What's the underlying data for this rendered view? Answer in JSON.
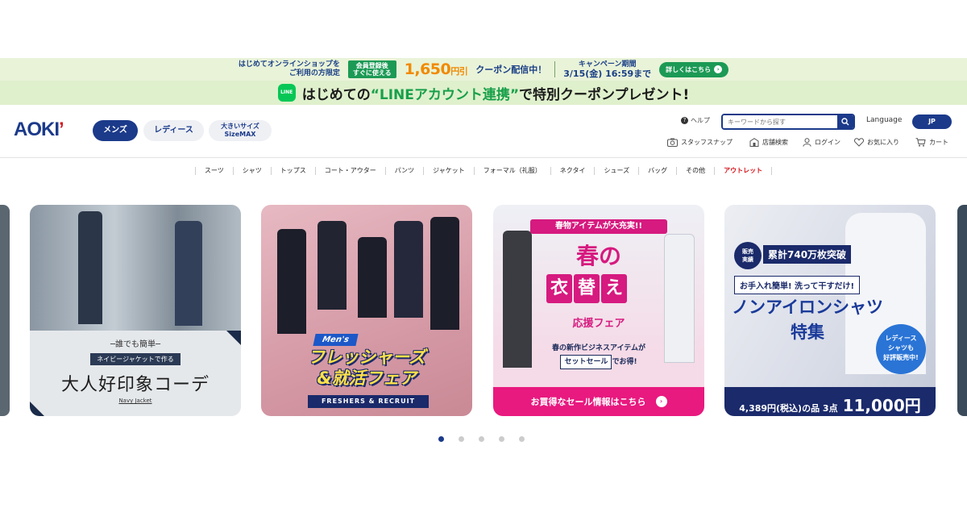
{
  "promo_top": {
    "lead_line1": "はじめてオンラインショップを",
    "lead_line2": "ご利用の方限定",
    "tag_line1": "会員登録後",
    "tag_line2": "すぐに使える",
    "amount": "1,650",
    "amount_unit": "円引",
    "coupon": "クーポン配信中！",
    "period_label": "キャンペーン期間",
    "period_value": "3/15(金) 16:59まで",
    "detail_button": "詳しくはこちら"
  },
  "promo_line": {
    "logo": "LINE",
    "text_pre": "はじめての",
    "text_em": "“LINEアカウント連携”",
    "text_post": "で特別クーポンプレゼント!"
  },
  "header": {
    "logo": "AOKI",
    "logo_mark": "’",
    "categories": [
      "メンズ",
      "レディース"
    ],
    "large_size_line1": "大きいサイズ",
    "large_size_line2": "SizeMAX",
    "help": "ヘルプ",
    "search_placeholder": "キーワードから探す",
    "language_label": "Language",
    "language_value": "JP",
    "utility": [
      "スタッフスナップ",
      "店舗検索",
      "ログイン",
      "お気に入り",
      "カート"
    ]
  },
  "nav": [
    "スーツ",
    "シャツ",
    "トップス",
    "コート・アウター",
    "パンツ",
    "ジャケット",
    "フォーマル（礼服）",
    "ネクタイ",
    "シューズ",
    "バッグ",
    "その他",
    "アウトレット"
  ],
  "carousel": {
    "card1": {
      "line1": "─誰でも簡単─",
      "line2": "ネイビージャケットで作る",
      "title": "大人好印象コーデ",
      "sub": "Navy Jacket"
    },
    "card2": {
      "label": "Men's",
      "title_line1": "フレッシャーズ",
      "title_line2": "&就活フェア",
      "sub": "FRESHERS & RECRUIT"
    },
    "card3": {
      "top": "春物アイテムが大充実!!",
      "haru": "春の",
      "koromo": [
        "衣",
        "替",
        "え"
      ],
      "ouen": "応援フェア",
      "desc_line1": "春の新作ビジネスアイテムが",
      "desc_box": "セットセール",
      "desc_line2": "でお得!",
      "bottom": "お買得なセール情報はこちら"
    },
    "card4": {
      "badge_line1": "販売",
      "badge_line2": "実績",
      "count": "累計740万枚突破",
      "easy": "お手入れ簡単! 洗って干すだけ!",
      "big_line1": "ノンアイロンシャツ",
      "big_line2": "特集",
      "ladies_line1": "レディース",
      "ladies_line2": "シャツも",
      "ladies_line3": "好評販売中!",
      "price_a": "4,389円(税込)の品 3点",
      "price_b": "11,000円"
    }
  },
  "dots_count": 5,
  "colors": {
    "brand": "#1b3a8a",
    "accent_red": "#d4151c",
    "line_green": "#06c755",
    "pink": "#d61a7f"
  }
}
